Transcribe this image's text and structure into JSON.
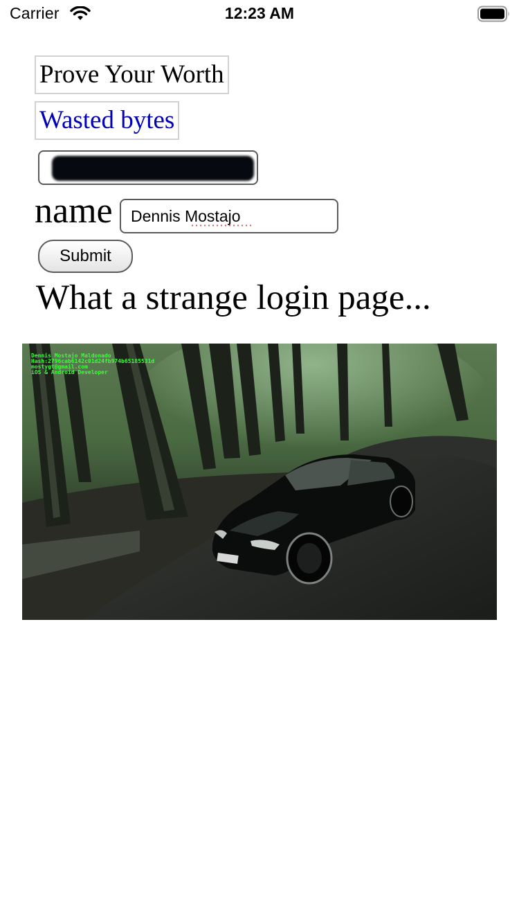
{
  "status_bar": {
    "carrier": "Carrier",
    "time": "12:23 AM",
    "wifi_icon": "wifi-icon",
    "battery_icon": "battery-full-icon"
  },
  "page": {
    "title_box": "Prove Your Worth",
    "link_box": "Wasted bytes",
    "password_field": {
      "value_state": "redacted"
    },
    "name_label": "name",
    "name_input_value": "Dennis Mostajo",
    "submit_label": "Submit",
    "tagline": "What a strange login page...",
    "photo": {
      "description_icon": "car-in-forest-photo",
      "caption_lines": [
        "Dennis Mostajo Maldonado",
        "Hash:2796cab6142c01d24fb974b65185531d",
        "mostygt@gmail.com",
        "iOS & Android Developer"
      ]
    }
  },
  "colors": {
    "link": "#0000b8",
    "caption_text": "#3cff3c",
    "field_border": "#5a5a5a",
    "box_border": "#d2d2d2"
  }
}
